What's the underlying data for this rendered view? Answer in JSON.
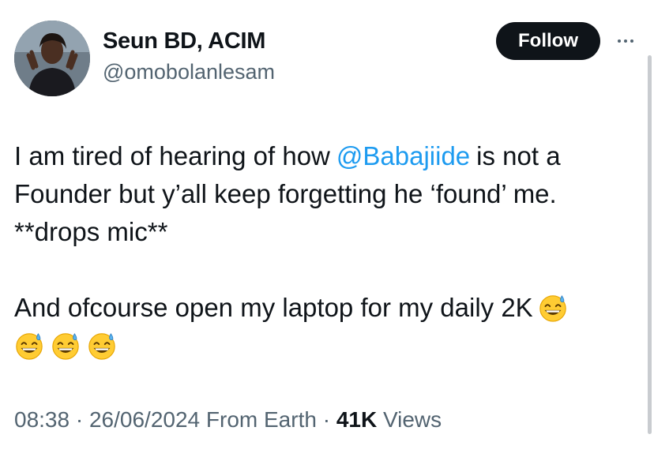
{
  "author": {
    "name": "Seun BD, ACIM",
    "handle": "@omobolanlesam"
  },
  "actions": {
    "follow_label": "Follow",
    "more_icon": "more-horizontal-icon"
  },
  "tweet": {
    "line1_before": "I am tired of hearing of how",
    "mention": "@Babajiide",
    "line1_after": "is not a Founder but y’all keep forgetting he ‘found’ me. **drops mic**",
    "line2": "And ofcourse open my laptop for my daily 2K",
    "emoji_name": "grinning-face-with-sweat"
  },
  "meta": {
    "time": "08:38",
    "date": "26/06/2024",
    "source": "From Earth",
    "views_count": "41K",
    "views_label": "Views",
    "separator": "·"
  },
  "colors": {
    "link": "#1d9bf0",
    "secondary_text": "#536471",
    "primary_text": "#0f1419",
    "button_bg": "#0f1419"
  }
}
